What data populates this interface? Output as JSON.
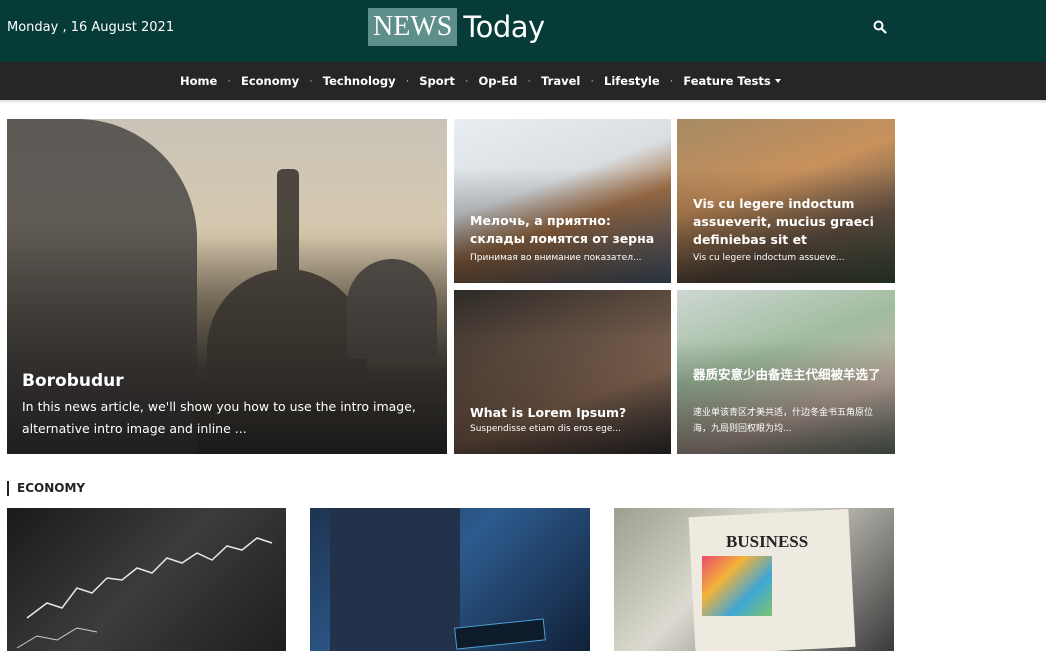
{
  "header": {
    "date": "Monday , 16 August 2021",
    "logo_left": "NEWS",
    "logo_right": "Today"
  },
  "nav": {
    "items": [
      "Home",
      "Economy",
      "Technology",
      "Sport",
      "Op-Ed",
      "Travel",
      "Lifestyle",
      "Feature Tests"
    ],
    "separator": "·"
  },
  "featured": {
    "main": {
      "title": "Borobudur",
      "intro": "In this news article, we'll show you how to use the intro image, alternative intro image and inline ..."
    },
    "cards": [
      {
        "title": "Мелочь, а приятно: склады ломятся от зерна",
        "intro": "Принимая во внимание показател..."
      },
      {
        "title": "Vis cu legere indoctum assueverit, mucius graeci definiebas sit et",
        "intro": "Vis cu legere indoctum assueve..."
      },
      {
        "title": "What is Lorem Ipsum?",
        "intro": "Suspendisse etiam dis eros ege..."
      },
      {
        "title": "器质安意少由备连主代细被羊选了",
        "intro": "速业单该青区才美共适，什边冬金书五角原位海，九局则回权眼为均..."
      }
    ]
  },
  "sections": {
    "economy_label": "ECONOMY",
    "economy_image_text": "BUSINESS"
  },
  "colors": {
    "topbar": "#063b37",
    "navbar": "#262626",
    "logo_box": "#5f8f8b"
  }
}
